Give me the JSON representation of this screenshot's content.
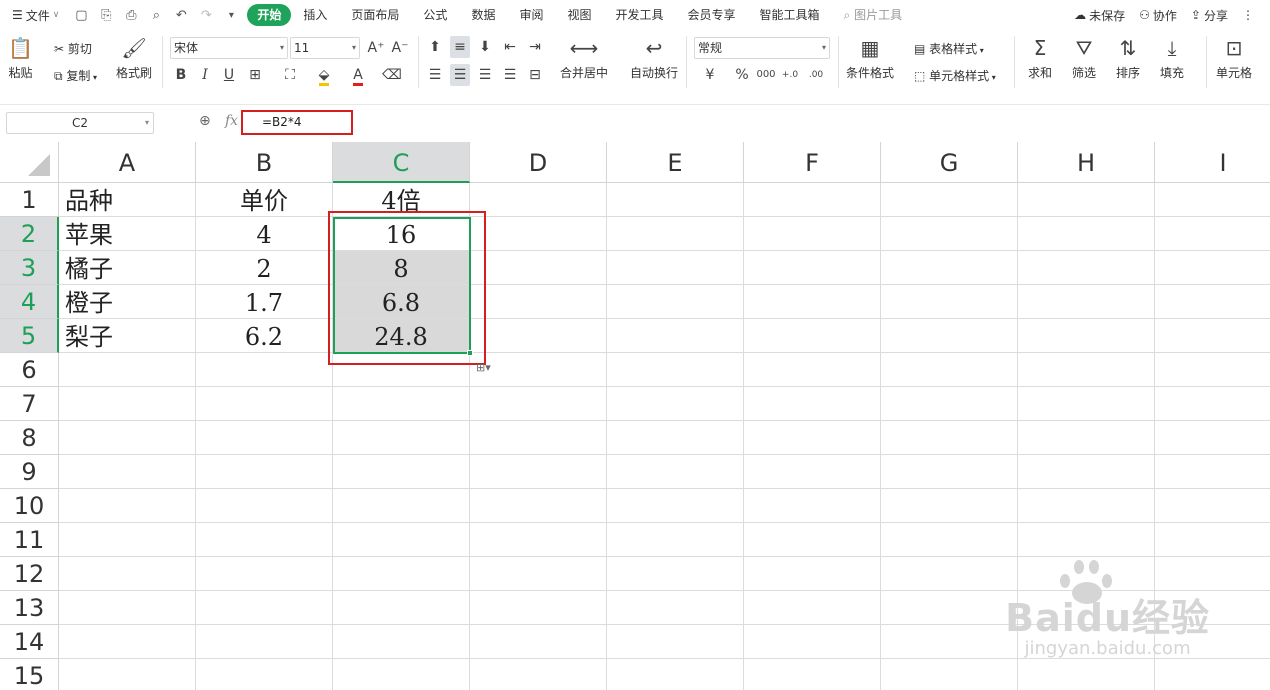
{
  "menubar": {
    "file_label": "文件",
    "tabs": [
      "开始",
      "插入",
      "页面布局",
      "公式",
      "数据",
      "审阅",
      "视图",
      "开发工具",
      "会员专享",
      "智能工具箱"
    ],
    "picture_tools": "图片工具",
    "unsaved": "未保存",
    "collaborate": "协作",
    "share": "分享"
  },
  "toolbar": {
    "paste": "粘贴",
    "cut": "剪切",
    "copy": "复制",
    "format_painter": "格式刷",
    "font_name": "宋体",
    "font_size": "11",
    "merge_center": "合并居中",
    "wrap_text": "自动换行",
    "number_format": "常规",
    "conditional_format": "条件格式",
    "table_style": "表格样式",
    "cell_style": "单元格样式",
    "sum": "求和",
    "filter": "筛选",
    "sort": "排序",
    "fill": "填充",
    "cell": "单元格"
  },
  "formula_bar": {
    "name_box": "C2",
    "fx": "fx",
    "formula": "=B2*4"
  },
  "sheet": {
    "columns": [
      "A",
      "B",
      "C",
      "D",
      "E",
      "F",
      "G",
      "H",
      "I"
    ],
    "rows": [
      "1",
      "2",
      "3",
      "4",
      "5",
      "6",
      "7",
      "8",
      "9",
      "10",
      "11",
      "12",
      "13",
      "14",
      "15"
    ],
    "cells": {
      "A1": "品种",
      "B1": "单价",
      "C1": "4倍",
      "A2": "苹果",
      "B2": "4",
      "C2": "16",
      "A3": "橘子",
      "B3": "2",
      "C3": "8",
      "A4": "橙子",
      "B4": "1.7",
      "C4": "6.8",
      "A5": "梨子",
      "B5": "6.2",
      "C5": "24.8"
    }
  },
  "watermark": {
    "logo": "Baidu经验",
    "url": "jingyan.baidu.com"
  },
  "colors": {
    "accent_green": "#1fa35b",
    "highlight_red": "#d21f1f",
    "selection_gray": "#d9d9d9"
  }
}
